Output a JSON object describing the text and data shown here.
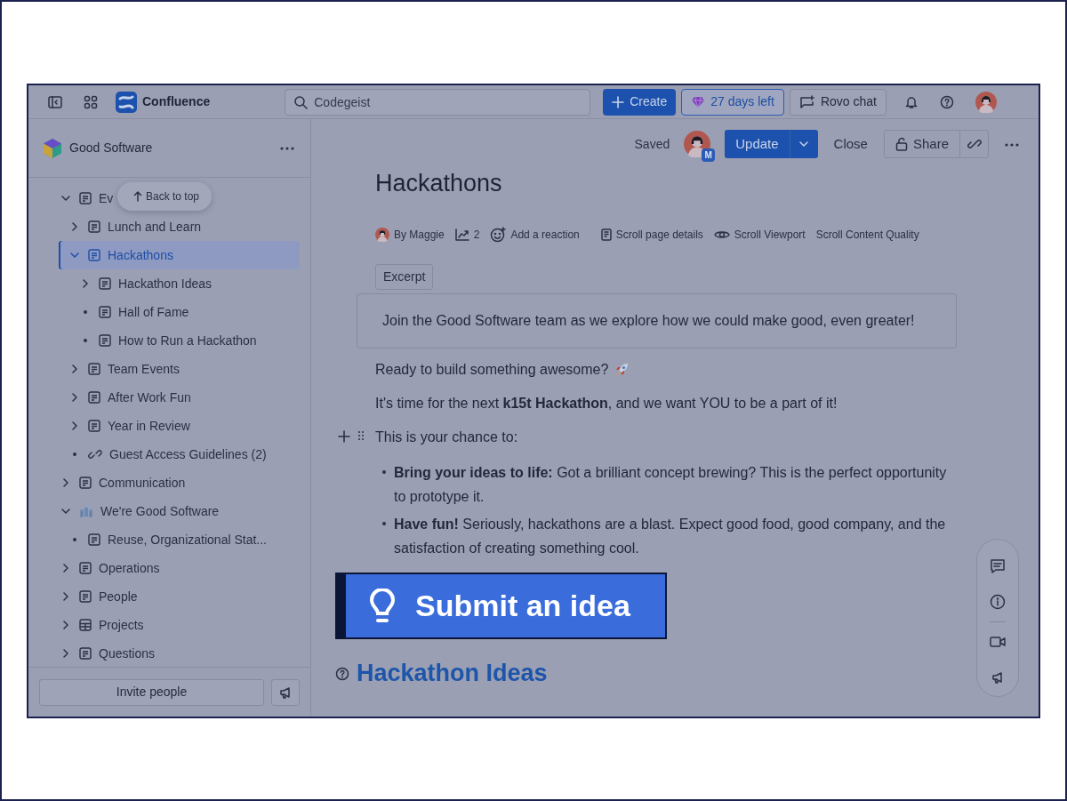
{
  "app": {
    "name": "Confluence"
  },
  "topbar": {
    "search_value": "Codegeist",
    "create": "Create",
    "trial": "27 days left",
    "rovo": "Rovo chat"
  },
  "sidebar": {
    "space": "Good Software",
    "back_to_top": "Back to top",
    "tree": [
      {
        "label": "Ev",
        "kind": "page",
        "expandable": true,
        "expanded": true,
        "selected": false,
        "children": [
          {
            "label": "Lunch and Learn",
            "kind": "page",
            "expandable": true,
            "expanded": false,
            "selected": false
          },
          {
            "label": "Hackathons",
            "kind": "page",
            "expandable": true,
            "expanded": true,
            "selected": true,
            "children": [
              {
                "label": "Hackathon Ideas",
                "kind": "page",
                "expandable": true,
                "expanded": false,
                "selected": false
              },
              {
                "label": "Hall of Fame",
                "kind": "page",
                "expandable": false,
                "selected": false
              },
              {
                "label": "How to Run a Hackathon",
                "kind": "page",
                "expandable": false,
                "selected": false
              }
            ]
          },
          {
            "label": "Team Events",
            "kind": "page",
            "expandable": true,
            "expanded": false,
            "selected": false
          },
          {
            "label": "After Work Fun",
            "kind": "page",
            "expandable": true,
            "expanded": false,
            "selected": false
          },
          {
            "label": "Year in Review",
            "kind": "page",
            "expandable": true,
            "expanded": false,
            "selected": false
          },
          {
            "label": "Guest Access Guidelines (2)",
            "kind": "link",
            "expandable": false,
            "selected": false
          }
        ]
      },
      {
        "label": "Communication",
        "kind": "page",
        "expandable": true,
        "expanded": false,
        "selected": false
      },
      {
        "label": "We're Good Software",
        "kind": "building",
        "expandable": true,
        "expanded": true,
        "selected": false,
        "children": [
          {
            "label": "Reuse, Organizational Stat...",
            "kind": "page",
            "expandable": false,
            "selected": false
          }
        ]
      },
      {
        "label": "Operations",
        "kind": "page",
        "expandable": true,
        "expanded": false,
        "selected": false
      },
      {
        "label": "People",
        "kind": "page",
        "expandable": true,
        "expanded": false,
        "selected": false
      },
      {
        "label": "Projects",
        "kind": "table",
        "expandable": true,
        "expanded": false,
        "selected": false
      },
      {
        "label": "Questions",
        "kind": "page",
        "expandable": true,
        "expanded": false,
        "selected": false
      }
    ],
    "invite": "Invite people"
  },
  "page_toolbar": {
    "status": "Saved",
    "avatar_badge": "M",
    "update": "Update",
    "close": "Close",
    "share": "Share"
  },
  "page": {
    "title": "Hackathons",
    "byline": [
      {
        "kind": "author",
        "label": "By Maggie"
      },
      {
        "kind": "views",
        "label": "2"
      },
      {
        "kind": "reaction",
        "label": "Add a reaction"
      },
      {
        "kind": "details",
        "label": "Scroll page details"
      },
      {
        "kind": "viewport",
        "label": "Scroll Viewport"
      },
      {
        "kind": "plain",
        "label": "Scroll Content Quality"
      }
    ],
    "excerpt_label": "Excerpt",
    "excerpt": "Join the Good Software team as we explore how we could make good, even greater!",
    "paragraphs": [
      {
        "text": "Ready to build something awesome?",
        "kind": "rocket"
      },
      {
        "text": "It's time for the next **k15t Hackathon**, and we want YOU to be a part of it!",
        "kind": "plain"
      }
    ],
    "lead_in": "This is your chance to:",
    "bullets": [
      "**Bring your ideas to life:** Got a brilliant concept brewing? This is the perfect opportunity to prototype it.",
      "**Have fun!** Seriously, hackathons are a blast. Expect good food, good company, and the satisfaction of creating something cool."
    ],
    "cta": "Submit an idea",
    "heading": "Hackathon Ideas"
  }
}
